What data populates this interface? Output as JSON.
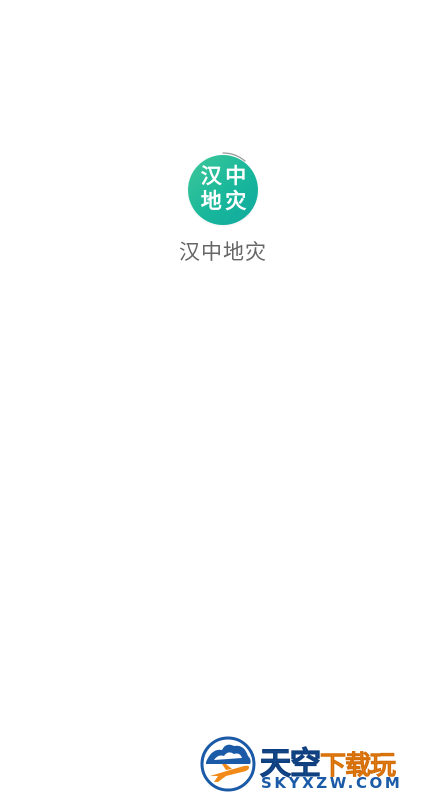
{
  "app": {
    "name": "汉中地灾",
    "logo_chars": [
      "汉",
      "中",
      "地",
      "灾"
    ],
    "logo_colors": {
      "start": "#3fc89a",
      "end": "#12a99f",
      "text": "#ffffff"
    }
  },
  "watermark": {
    "brand": "天空",
    "sub": "下载玩",
    "domain": "SKYXZW.COM",
    "colors": {
      "blue": "#1a5aa6",
      "orange": "#f28a1a"
    },
    "icons": [
      "airplane-icon",
      "cloud-icon"
    ]
  }
}
